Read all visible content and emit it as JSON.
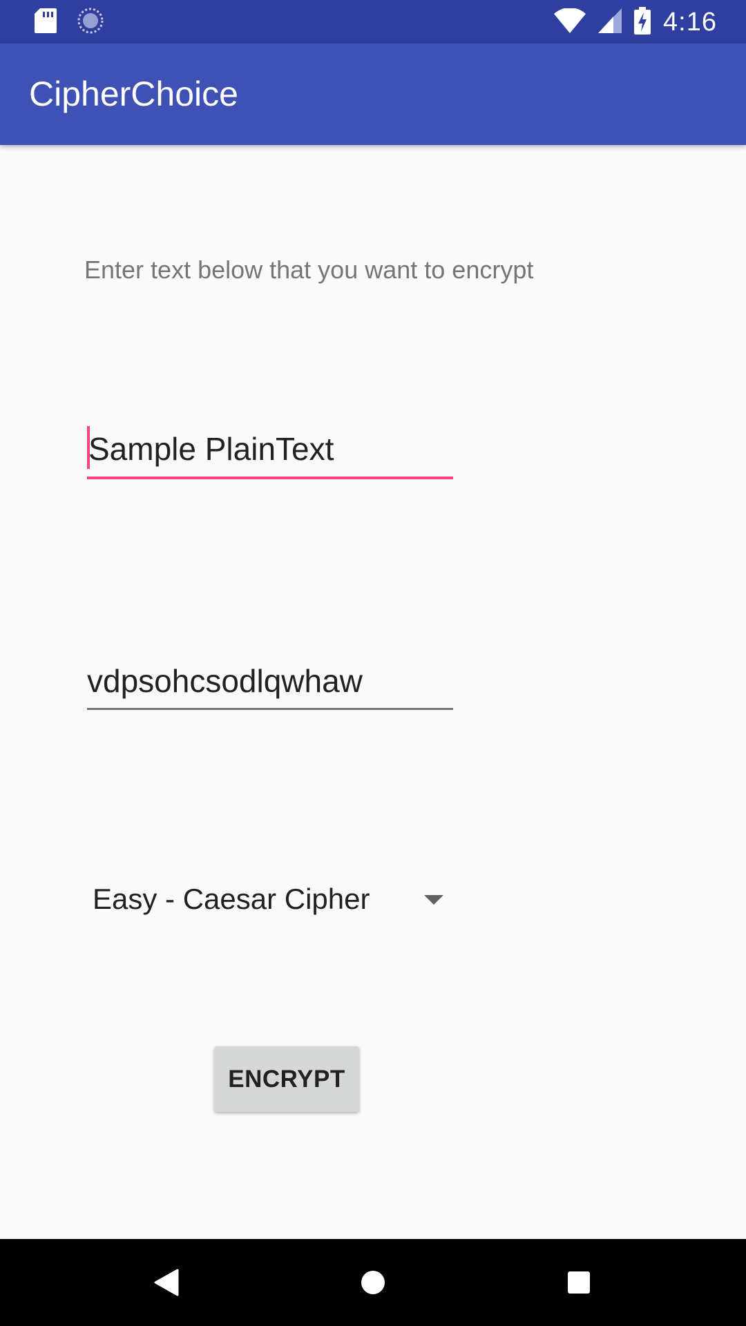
{
  "status_bar": {
    "time": "4:16",
    "icons": [
      "sd-card-icon",
      "sync-icon",
      "wifi-icon",
      "cell-signal-icon",
      "battery-charging-icon"
    ],
    "background_color": "#303f9f"
  },
  "app_bar": {
    "title": "CipherChoice",
    "background_color": "#3f51b5"
  },
  "main": {
    "instruction": "Enter text below that you want to encrypt",
    "plaintext_input": {
      "value": "Sample PlainText",
      "focused": true,
      "accent_color": "#ff4081"
    },
    "ciphertext_output": {
      "value": "vdpsohcsodlqwhaw"
    },
    "cipher_select": {
      "selected": "Easy - Caesar Cipher"
    },
    "encrypt_button": {
      "label": "ENCRYPT"
    }
  },
  "nav_bar": {
    "buttons": [
      "back-icon",
      "home-icon",
      "recents-icon"
    ]
  }
}
